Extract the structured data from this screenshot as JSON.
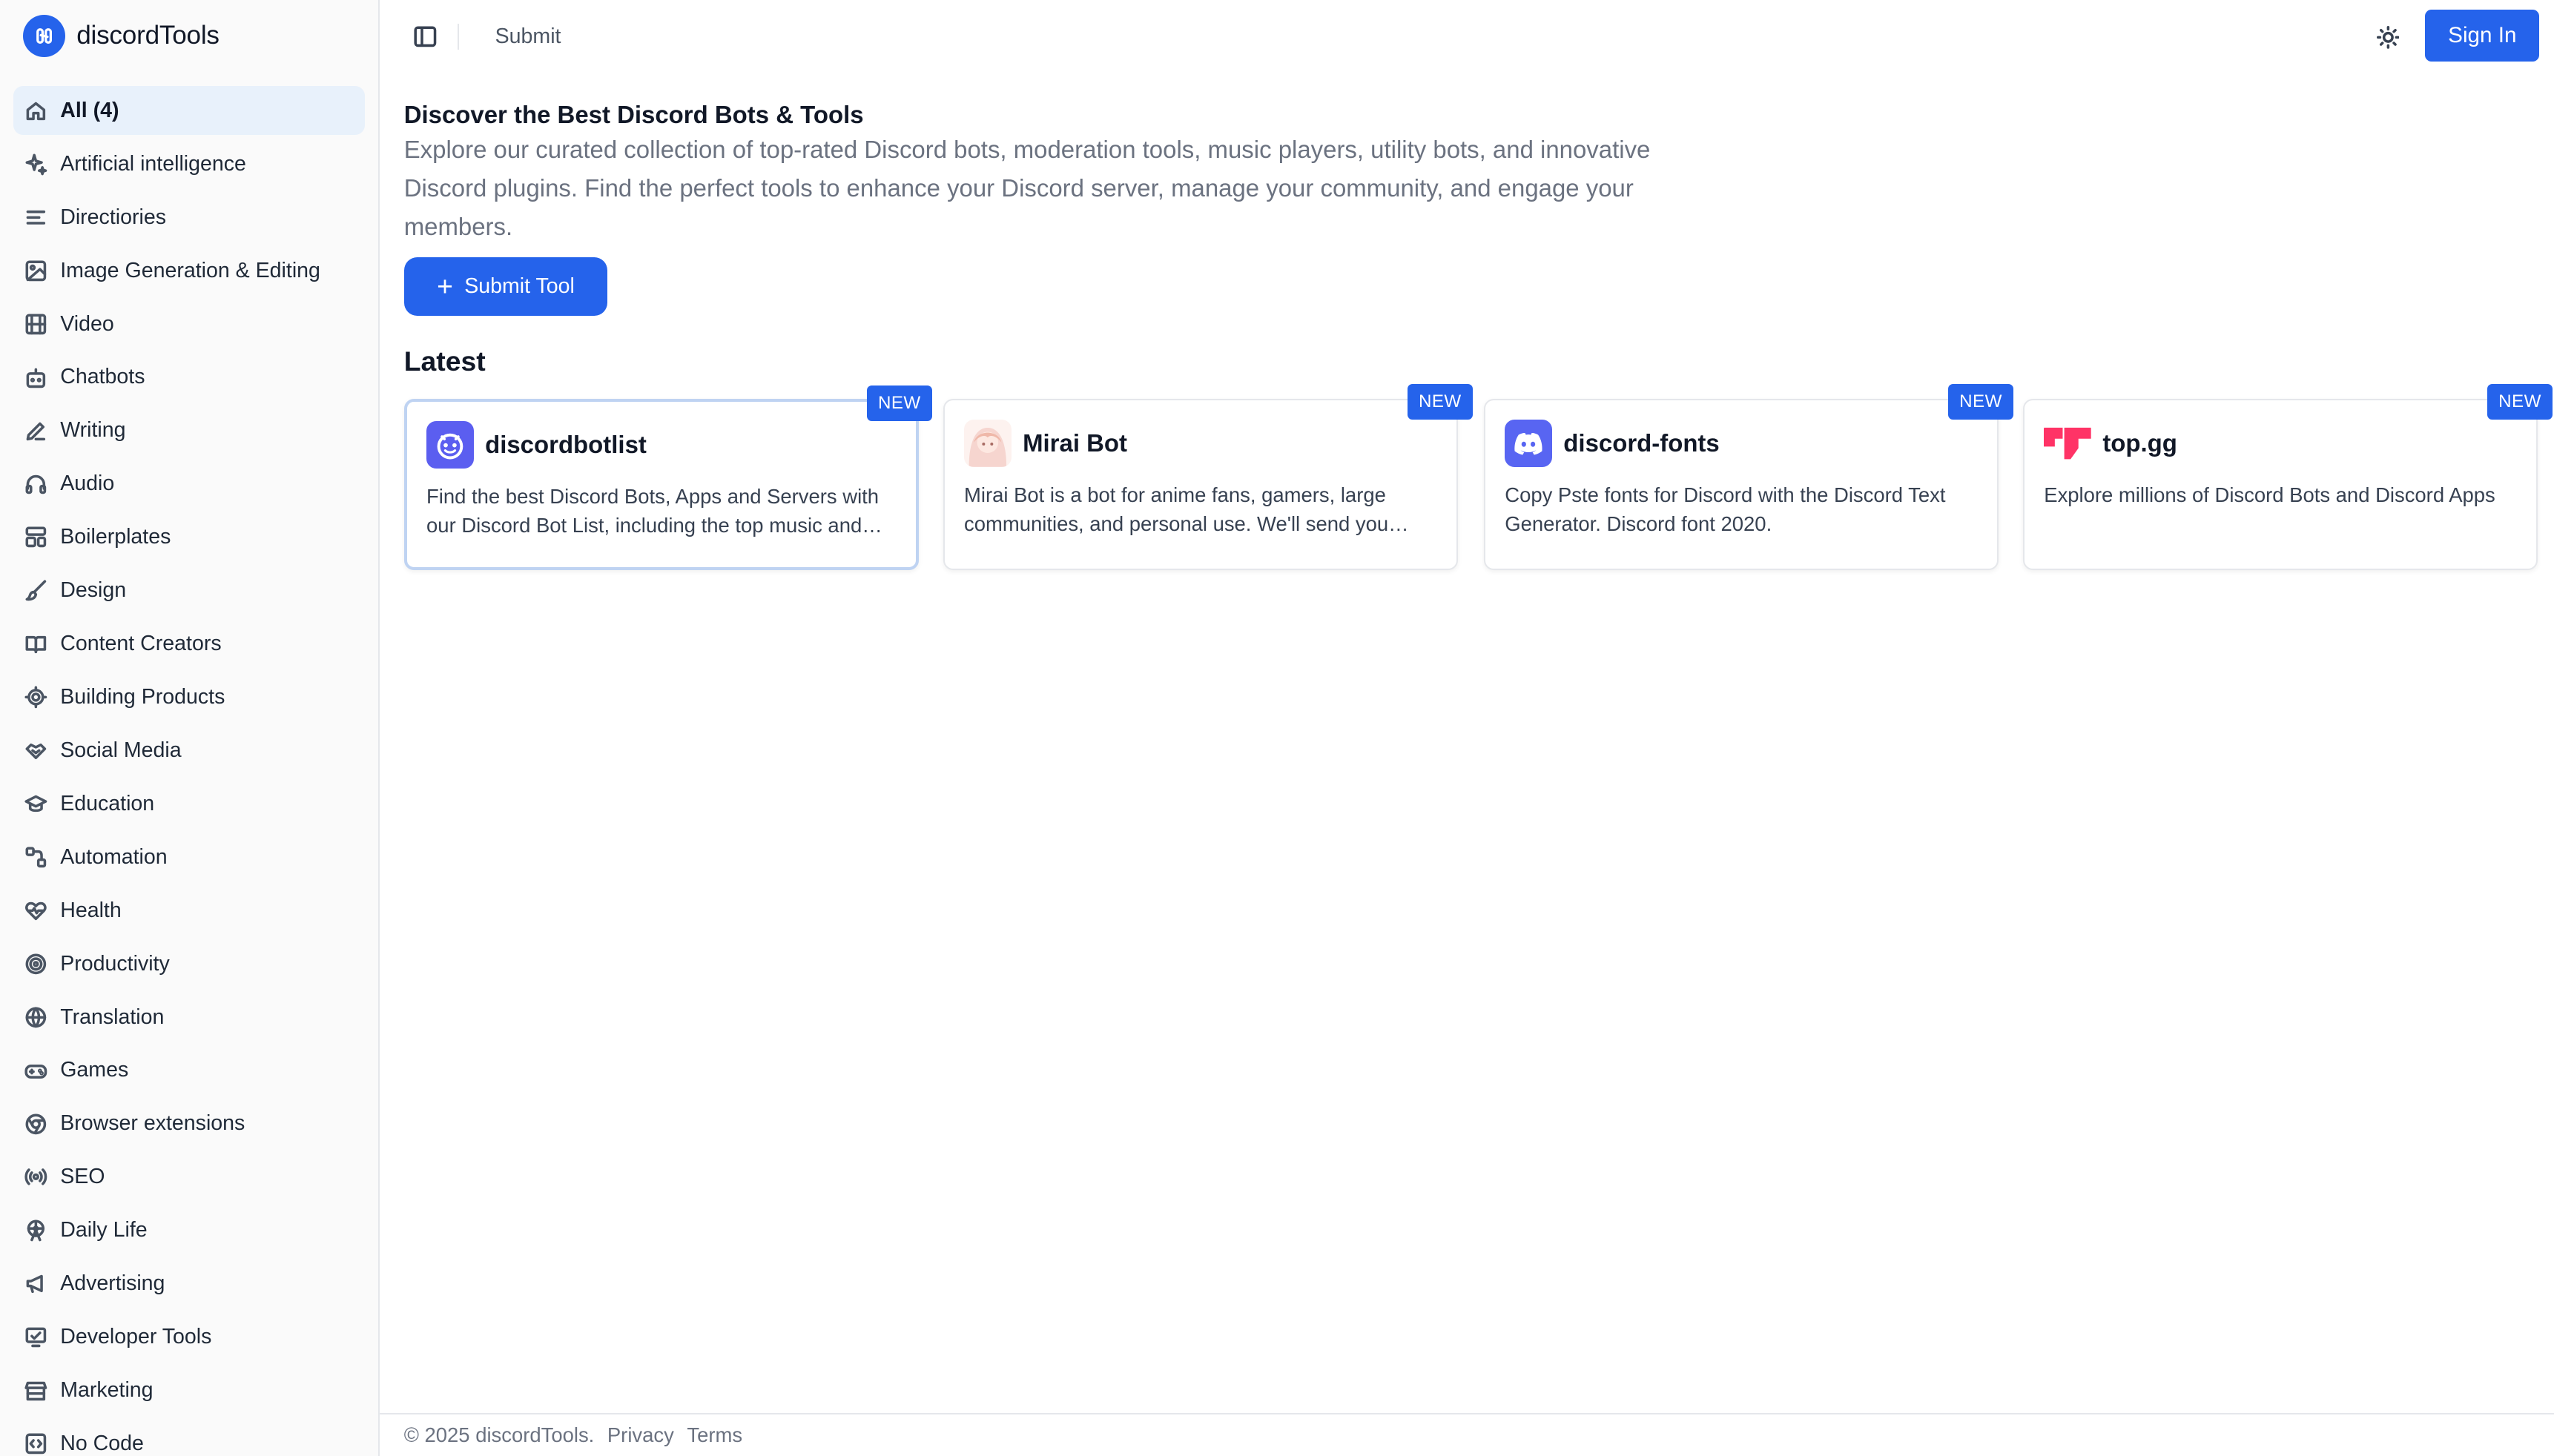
{
  "brand": {
    "name": "discordTools"
  },
  "sidebar": {
    "items": [
      {
        "label": "All (4)",
        "icon": "home-icon",
        "active": true
      },
      {
        "label": "Artificial intelligence",
        "icon": "sparkle-icon"
      },
      {
        "label": "Directiories",
        "icon": "list-icon"
      },
      {
        "label": "Image Generation & Editing",
        "icon": "image-icon"
      },
      {
        "label": "Video",
        "icon": "film-icon"
      },
      {
        "label": "Chatbots",
        "icon": "bot-icon"
      },
      {
        "label": "Writing",
        "icon": "pen-icon"
      },
      {
        "label": "Audio",
        "icon": "headphones-icon"
      },
      {
        "label": "Boilerplates",
        "icon": "layout-icon"
      },
      {
        "label": "Design",
        "icon": "brush-icon"
      },
      {
        "label": "Content Creators",
        "icon": "book-open-icon"
      },
      {
        "label": "Building Products",
        "icon": "cog-icon"
      },
      {
        "label": "Social Media",
        "icon": "handshake-icon"
      },
      {
        "label": "Education",
        "icon": "graduation-cap-icon"
      },
      {
        "label": "Automation",
        "icon": "workflow-icon"
      },
      {
        "label": "Health",
        "icon": "heart-pulse-icon"
      },
      {
        "label": "Productivity",
        "icon": "target-icon"
      },
      {
        "label": "Translation",
        "icon": "globe-icon"
      },
      {
        "label": "Games",
        "icon": "gamepad-icon"
      },
      {
        "label": "Browser extensions",
        "icon": "chrome-icon"
      },
      {
        "label": "SEO",
        "icon": "radio-icon"
      },
      {
        "label": "Daily Life",
        "icon": "ferris-wheel-icon"
      },
      {
        "label": "Advertising",
        "icon": "megaphone-icon"
      },
      {
        "label": "Developer Tools",
        "icon": "monitor-icon"
      },
      {
        "label": "Marketing",
        "icon": "store-icon"
      },
      {
        "label": "No Code",
        "icon": "code-square-icon"
      }
    ]
  },
  "topbar": {
    "submit_label": "Submit",
    "signin_label": "Sign In"
  },
  "hero": {
    "title": "Discover the Best Discord Bots & Tools",
    "description": "Explore our curated collection of top-rated Discord bots, moderation tools, music players, utility bots, and innovative Discord plugins. Find the perfect tools to enhance your Discord server, manage your community, and engage your members.",
    "submit_button": "Submit Tool"
  },
  "latest": {
    "heading": "Latest",
    "cards": [
      {
        "name": "discordbotlist",
        "badge": "NEW",
        "description": "Find the best Discord Bots, Apps and Servers with our Discord Bot List, including the top music and economy bots.",
        "logo": "discordbotlist-logo",
        "logo_color": "#5b5ef0"
      },
      {
        "name": "Mirai Bot",
        "badge": "NEW",
        "description": "Mirai Bot is a bot for anime fans, gamers, large communities, and personal use. We'll send you updates and more.",
        "logo": "anime-avatar-logo",
        "logo_color": "#f6d5cf"
      },
      {
        "name": "discord-fonts",
        "badge": "NEW",
        "description": "Copy Pste fonts for Discord with the Discord Text Generator. Discord font 2020.",
        "logo": "discord-logo",
        "logo_color": "#5865f2"
      },
      {
        "name": "top.gg",
        "badge": "NEW",
        "description": "Explore millions of Discord Bots and Discord Apps",
        "logo": "topgg-logo",
        "logo_color": "#ff3366"
      }
    ]
  },
  "footer": {
    "copyright": "© 2025 discordTools.",
    "privacy": "Privacy",
    "terms": "Terms"
  },
  "colors": {
    "accent": "#2563eb",
    "active_bg": "#e8f1fb",
    "sidebar_bg": "#fafafa"
  }
}
